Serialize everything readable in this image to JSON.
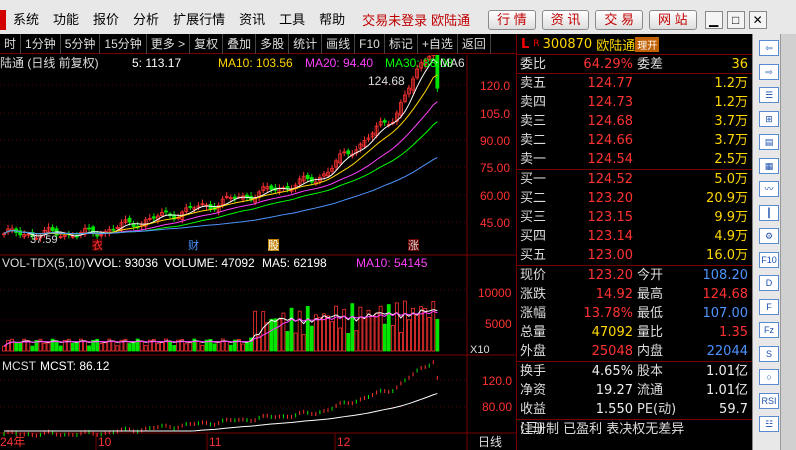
{
  "menu": {
    "items": [
      "系统",
      "功能",
      "报价",
      "分析",
      "扩展行情",
      "资讯",
      "工具",
      "帮助"
    ],
    "trade_status": "交易未登录",
    "broker": "欧陆通",
    "buttons": [
      "行 情",
      "资 讯",
      "交 易",
      "网 站"
    ],
    "window_controls": [
      "▁",
      "□",
      "✕"
    ]
  },
  "toolbar": {
    "items": [
      "时",
      "1分钟",
      "5分钟",
      "15分钟",
      "更多 >",
      "复权",
      "叠加",
      "多股",
      "统计",
      "画线",
      "F10",
      "标记",
      "+自选",
      "返回"
    ]
  },
  "main_chart": {
    "title": "陆通 (日线 前复权)",
    "ma5": "5: 113.17",
    "ma10": "MA10: 103.56",
    "ma20": "MA20: 94.40",
    "ma30": "MA30: 88.08",
    "ma_more": "MA6",
    "high_label": "124.68",
    "low_label": "37.59",
    "y_ticks": [
      "120.0",
      "105.0",
      "90.00",
      "75.00",
      "60.00",
      "45.00"
    ],
    "event_markers": [
      "衣",
      "财",
      "股",
      "涨"
    ]
  },
  "vol_chart": {
    "title": "VOL-TDX(5,10)",
    "vvol": "VVOL: 93036",
    "volume": "VOLUME: 47092",
    "ma5": "MA5: 62198",
    "ma10": "MA10: 54145",
    "y_ticks": [
      "10000",
      "5000"
    ],
    "unit": "X10"
  },
  "mcst_chart": {
    "title": "MCST",
    "value": "MCST: 86.12",
    "y_ticks": [
      "120.0",
      "80.00"
    ]
  },
  "x_axis": {
    "labels": [
      "24年",
      "10",
      "11",
      "12"
    ],
    "period": "日线"
  },
  "colors": {
    "up": "#ff3232",
    "down": "#00e600",
    "ma5": "#ffffff",
    "ma10": "#ffd700",
    "ma20": "#ff40ff",
    "ma30": "#00ff00",
    "ma60": "#4d94ff",
    "frame": "#7a0000"
  },
  "quote": {
    "L": "L",
    "R": "R",
    "code": "300870",
    "name": "欧陆通",
    "tag": "理开",
    "webi_label": "委比",
    "webi": "64.29%",
    "weicha_label": "委差",
    "weicha": "36",
    "asks": [
      {
        "label": "卖五",
        "price": "124.77",
        "vol": "1.2万"
      },
      {
        "label": "卖四",
        "price": "124.73",
        "vol": "1.2万"
      },
      {
        "label": "卖三",
        "price": "124.68",
        "vol": "3.7万"
      },
      {
        "label": "卖二",
        "price": "124.66",
        "vol": "3.7万"
      },
      {
        "label": "卖一",
        "price": "124.54",
        "vol": "2.5万"
      }
    ],
    "bids": [
      {
        "label": "买一",
        "price": "124.52",
        "vol": "5.0万"
      },
      {
        "label": "买二",
        "price": "123.20",
        "vol": "20.9万"
      },
      {
        "label": "买三",
        "price": "123.15",
        "vol": "9.9万"
      },
      {
        "label": "买四",
        "price": "123.14",
        "vol": "4.9万"
      },
      {
        "label": "买五",
        "price": "123.00",
        "vol": "16.0万"
      }
    ],
    "stats": [
      {
        "l1": "现价",
        "v1": "123.20",
        "c1": "red",
        "l2": "今开",
        "v2": "108.20",
        "c2": "blue"
      },
      {
        "l1": "涨跌",
        "v1": "14.92",
        "c1": "red",
        "l2": "最高",
        "v2": "124.68",
        "c2": "red"
      },
      {
        "l1": "涨幅",
        "v1": "13.78%",
        "c1": "red",
        "l2": "最低",
        "v2": "107.00",
        "c2": "blue"
      },
      {
        "l1": "总量",
        "v1": "47092",
        "c1": "yellow",
        "l2": "量比",
        "v2": "1.35",
        "c2": "red"
      },
      {
        "l1": "外盘",
        "v1": "25048",
        "c1": "red",
        "l2": "内盘",
        "v2": "22044",
        "c2": "blue"
      }
    ],
    "fund": [
      {
        "l1": "换手",
        "v1": "4.65%",
        "l2": "股本",
        "v2": "1.01亿"
      },
      {
        "l1": "净资",
        "v1": "19.27",
        "l2": "流通",
        "v2": "1.01亿"
      },
      {
        "l1": "收益(三)",
        "v1": "1.550",
        "l2": "PE(动)",
        "v2": "59.7"
      }
    ],
    "footer": "注册制 已盈利 表决权无差异"
  },
  "sidebar": {
    "icons": [
      "back-icon",
      "forward-icon",
      "list-icon",
      "grid-icon",
      "table-icon",
      "stat-icon",
      "chart-line-icon",
      "kline-icon",
      "tools-icon",
      "f10-icon",
      "dde-icon",
      "f-icon",
      "fz-icon",
      "s-icon",
      "c-icon",
      "rsi-icon",
      "expand-icon"
    ],
    "labels": [
      "⇦",
      "⇨",
      "☰",
      "⊞",
      "▤",
      "▦",
      "〰",
      "┃",
      "⚙",
      "F10",
      "D",
      "F",
      "Fz",
      "S",
      "○",
      "RSI",
      "☳"
    ]
  }
}
